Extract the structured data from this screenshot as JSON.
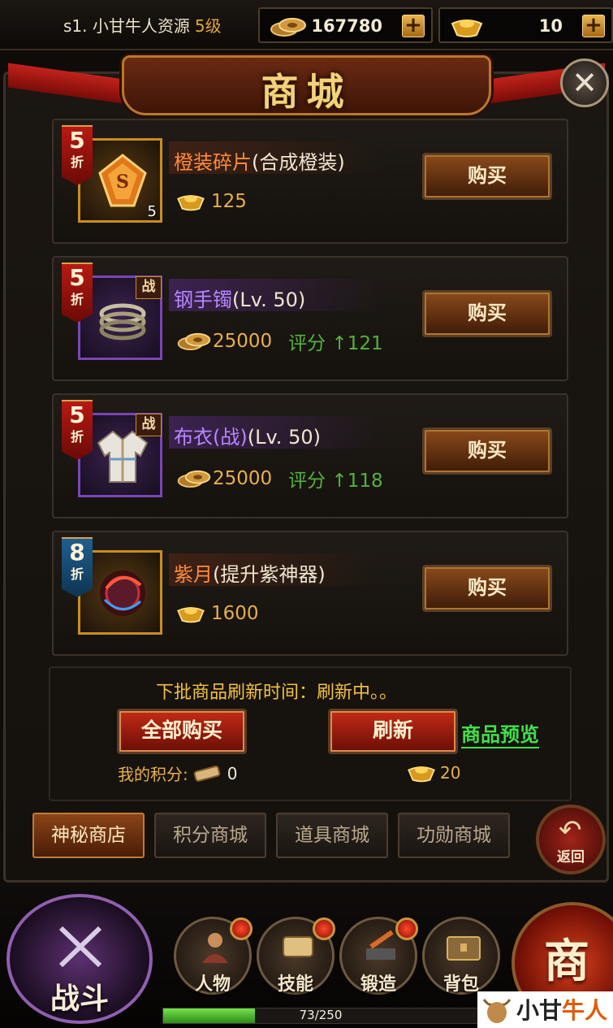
{
  "topbar": {
    "server_name": "s1. 小甘牛人资源",
    "level": "5级",
    "coins": "167780",
    "gold": "10"
  },
  "shop": {
    "title": "商城"
  },
  "items": [
    {
      "discount": "5",
      "discount_unit": "折",
      "name_main": "橙装碎片",
      "name_sub": "(合成橙装)",
      "stack": "5",
      "currency": "gold-ingot",
      "price": "125",
      "score_label": "",
      "score_value": "",
      "buy_label": "购买",
      "quality": "orange"
    },
    {
      "discount": "5",
      "discount_unit": "折",
      "name_main": "钢手镯",
      "name_sub": "(Lv. 50)",
      "badge": "战",
      "currency": "coin",
      "price": "25000",
      "score_label": "评分",
      "score_value": "121",
      "buy_label": "购买",
      "quality": "purple"
    },
    {
      "discount": "5",
      "discount_unit": "折",
      "name_main": "布衣(战)",
      "name_sub": "(Lv. 50)",
      "badge": "战",
      "currency": "coin",
      "price": "25000",
      "score_label": "评分",
      "score_value": "118",
      "buy_label": "购买",
      "quality": "purple"
    },
    {
      "discount": "8",
      "discount_unit": "折",
      "name_main": "紫月",
      "name_sub": "(提升紫神器)",
      "currency": "gold-ingot",
      "price": "1600",
      "score_label": "",
      "score_value": "",
      "buy_label": "购买",
      "quality": "orange"
    }
  ],
  "refresh": {
    "next_batch_text": "下批商品刷新时间：刷新中。。",
    "buy_all_label": "全部购买",
    "refresh_label": "刷新",
    "preview_label": "商品预览",
    "my_points_label": "我的积分:",
    "my_points_value": "0",
    "refresh_cost": "20"
  },
  "tabs": [
    {
      "label": "神秘商店",
      "active": true
    },
    {
      "label": "积分商城",
      "active": false
    },
    {
      "label": "道具商城",
      "active": false
    },
    {
      "label": "功勋商城",
      "active": false
    }
  ],
  "back_label": "返回",
  "bottom_nav": {
    "battle_label": "战斗",
    "items": [
      {
        "label": "人物"
      },
      {
        "label": "技能"
      },
      {
        "label": "锻造"
      },
      {
        "label": "背包"
      }
    ],
    "shop_label": "商",
    "exp_text": "73/250",
    "exp_fraction": 0.292
  },
  "watermark": {
    "text_a": "小甘",
    "text_b": "牛人"
  },
  "colors": {
    "accent_gold": "#f2c23d",
    "preview_green": "#3fe04a",
    "score_green": "#53b33a",
    "orange_quality": "#ff8b3c",
    "purple_quality": "#b687ff"
  }
}
